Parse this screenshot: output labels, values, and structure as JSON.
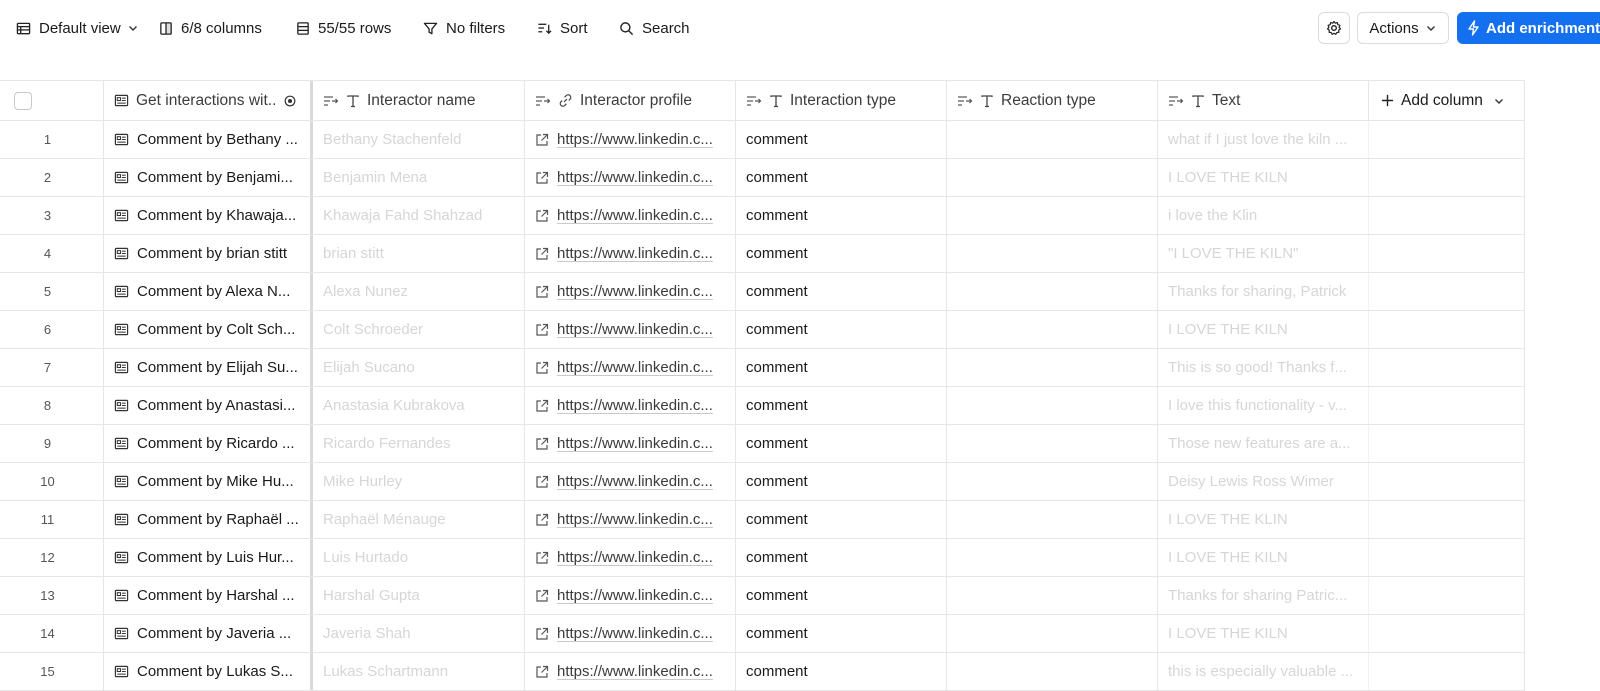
{
  "toolbar": {
    "view_label": "Default view",
    "columns_label": "6/8 columns",
    "rows_label": "55/55 rows",
    "filters_label": "No filters",
    "sort_label": "Sort",
    "search_label": "Search",
    "actions_label": "Actions",
    "enrich_label": "Add enrichment",
    "accent_color": "#1570ef"
  },
  "columns": [
    {
      "label": "Get interactions wit..",
      "icon": "enrichment-doc-icon"
    },
    {
      "label": "Interactor name",
      "icon": "text-type-icon"
    },
    {
      "label": "Interactor profile",
      "icon": "link-icon"
    },
    {
      "label": "Interaction type",
      "icon": "text-type-icon"
    },
    {
      "label": "Reaction type",
      "icon": "text-type-icon"
    },
    {
      "label": "Text",
      "icon": "text-type-icon"
    },
    {
      "label": "Add column",
      "icon": "plus-icon"
    }
  ],
  "rows": [
    {
      "num": "1",
      "source": "Comment by Bethany ...",
      "name": "Bethany Stachenfeld",
      "profile": "https://www.linkedin.c...",
      "type": "comment",
      "reaction": "",
      "text": "what if I just love the kiln ..."
    },
    {
      "num": "2",
      "source": "Comment by Benjami...",
      "name": "Benjamin Mena",
      "profile": "https://www.linkedin.c...",
      "type": "comment",
      "reaction": "",
      "text": "I LOVE THE KILN"
    },
    {
      "num": "3",
      "source": "Comment by Khawaja...",
      "name": "Khawaja Fahd Shahzad",
      "profile": "https://www.linkedin.c...",
      "type": "comment",
      "reaction": "",
      "text": "i love the Klin"
    },
    {
      "num": "4",
      "source": "Comment by brian stitt",
      "name": "brian stitt",
      "profile": "https://www.linkedin.c...",
      "type": "comment",
      "reaction": "",
      "text": "\"I LOVE THE KILN\""
    },
    {
      "num": "5",
      "source": "Comment by Alexa N...",
      "name": "Alexa Nunez",
      "profile": "https://www.linkedin.c...",
      "type": "comment",
      "reaction": "",
      "text": "Thanks for sharing, Patrick"
    },
    {
      "num": "6",
      "source": "Comment by Colt Sch...",
      "name": "Colt Schroeder",
      "profile": "https://www.linkedin.c...",
      "type": "comment",
      "reaction": "",
      "text": "I LOVE THE KILN"
    },
    {
      "num": "7",
      "source": "Comment by Elijah Su...",
      "name": "Elijah Sucano",
      "profile": "https://www.linkedin.c...",
      "type": "comment",
      "reaction": "",
      "text": "This is so good! Thanks f..."
    },
    {
      "num": "8",
      "source": "Comment by Anastasi...",
      "name": "Anastasia Kubrakova",
      "profile": "https://www.linkedin.c...",
      "type": "comment",
      "reaction": "",
      "text": "I love this functionality - v..."
    },
    {
      "num": "9",
      "source": "Comment by Ricardo ...",
      "name": "Ricardo Fernandes",
      "profile": "https://www.linkedin.c...",
      "type": "comment",
      "reaction": "",
      "text": "Those new features are a..."
    },
    {
      "num": "10",
      "source": "Comment by Mike Hu...",
      "name": "Mike Hurley",
      "profile": "https://www.linkedin.c...",
      "type": "comment",
      "reaction": "",
      "text": "Deisy Lewis Ross Wimer"
    },
    {
      "num": "11",
      "source": "Comment by Raphaël ...",
      "name": "Raphaël Ménauge",
      "profile": "https://www.linkedin.c...",
      "type": "comment",
      "reaction": "",
      "text": "I LOVE THE KLIN"
    },
    {
      "num": "12",
      "source": "Comment by Luis Hur...",
      "name": "Luis Hurtado",
      "profile": "https://www.linkedin.c...",
      "type": "comment",
      "reaction": "",
      "text": "I LOVE THE KILN"
    },
    {
      "num": "13",
      "source": "Comment by Harshal ...",
      "name": "Harshal Gupta",
      "profile": "https://www.linkedin.c...",
      "type": "comment",
      "reaction": "",
      "text": "Thanks for sharing Patric..."
    },
    {
      "num": "14",
      "source": "Comment by Javeria ...",
      "name": "Javeria Shah",
      "profile": "https://www.linkedin.c...",
      "type": "comment",
      "reaction": "",
      "text": "I LOVE THE KILN"
    },
    {
      "num": "15",
      "source": "Comment by Lukas S...",
      "name": "Lukas Schartmann",
      "profile": "https://www.linkedin.c...",
      "type": "comment",
      "reaction": "",
      "text": "this is especially valuable ..."
    }
  ]
}
